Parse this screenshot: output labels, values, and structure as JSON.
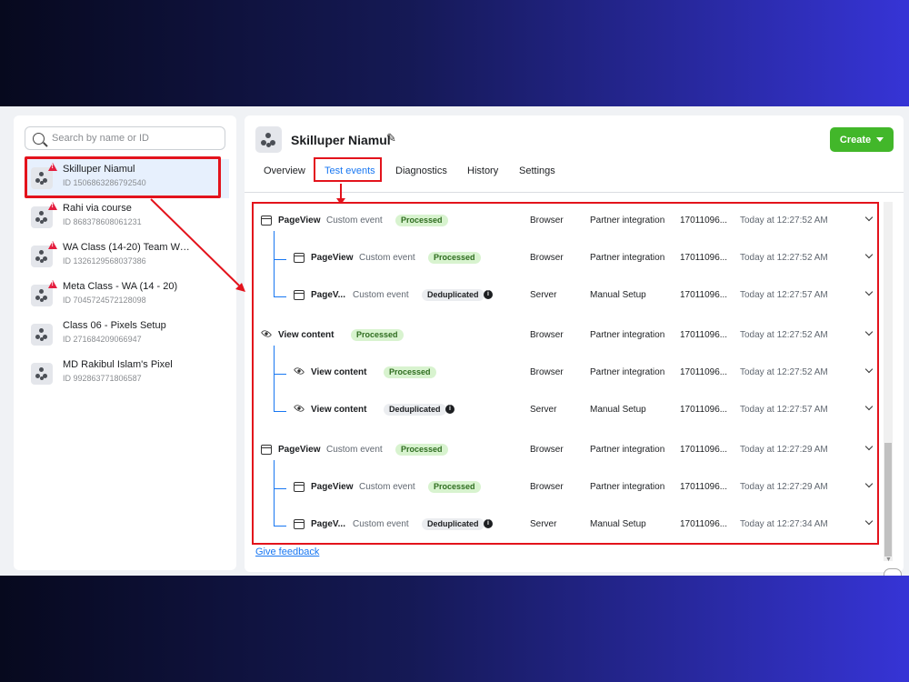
{
  "search": {
    "placeholder": "Search by name or ID"
  },
  "pixels": [
    {
      "name": "Skilluper Niamul",
      "id": "ID 1506863286792540",
      "warning": true,
      "selected": true
    },
    {
      "name": "Rahi via course",
      "id": "ID 868378608061231",
      "warning": true,
      "selected": false
    },
    {
      "name": "WA Class (14-20) Team Wor...",
      "id": "ID 1326129568037386",
      "warning": true,
      "selected": false
    },
    {
      "name": "Meta Class - WA (14 - 20)",
      "id": "ID 7045724572128098",
      "warning": true,
      "selected": false
    },
    {
      "name": "Class 06 - Pixels Setup",
      "id": "ID 271684209066947",
      "warning": false,
      "selected": false
    },
    {
      "name": "MD Rakibul Islam's Pixel",
      "id": "ID 992863771806587",
      "warning": false,
      "selected": false
    }
  ],
  "header": {
    "title": "Skilluper Niamul",
    "create_label": "Create"
  },
  "tabs": [
    {
      "label": "Overview",
      "active": false
    },
    {
      "label": "Test events",
      "active": true
    },
    {
      "label": "Diagnostics",
      "active": false
    },
    {
      "label": "History",
      "active": false
    },
    {
      "label": "Settings",
      "active": false
    }
  ],
  "events": [
    {
      "icon": "page-icon",
      "name": "PageView",
      "sub": "Custom event",
      "status": "Processed",
      "source": "Browser",
      "setup": "Partner integration",
      "event_id": "17011096...",
      "time": "Today at 12:27:52 AM",
      "child": false
    },
    {
      "icon": "page-icon",
      "name": "PageView",
      "sub": "Custom event",
      "status": "Processed",
      "source": "Browser",
      "setup": "Partner integration",
      "event_id": "17011096...",
      "time": "Today at 12:27:52 AM",
      "child": true
    },
    {
      "icon": "page-icon",
      "name": "PageV...",
      "sub": "Custom event",
      "status": "Deduplicated",
      "source": "Server",
      "setup": "Manual Setup",
      "event_id": "17011096...",
      "time": "Today at 12:27:57 AM",
      "child": true
    },
    {
      "icon": "eye-icon",
      "name": "View content",
      "sub": "",
      "status": "Processed",
      "source": "Browser",
      "setup": "Partner integration",
      "event_id": "17011096...",
      "time": "Today at 12:27:52 AM",
      "child": false
    },
    {
      "icon": "eye-icon",
      "name": "View content",
      "sub": "",
      "status": "Processed",
      "source": "Browser",
      "setup": "Partner integration",
      "event_id": "17011096...",
      "time": "Today at 12:27:52 AM",
      "child": true
    },
    {
      "icon": "eye-icon",
      "name": "View content",
      "sub": "",
      "status": "Deduplicated",
      "source": "Server",
      "setup": "Manual Setup",
      "event_id": "17011096...",
      "time": "Today at 12:27:57 AM",
      "child": true
    },
    {
      "icon": "page-icon",
      "name": "PageView",
      "sub": "Custom event",
      "status": "Processed",
      "source": "Browser",
      "setup": "Partner integration",
      "event_id": "17011096...",
      "time": "Today at 12:27:29 AM",
      "child": false
    },
    {
      "icon": "page-icon",
      "name": "PageView",
      "sub": "Custom event",
      "status": "Processed",
      "source": "Browser",
      "setup": "Partner integration",
      "event_id": "17011096...",
      "time": "Today at 12:27:29 AM",
      "child": true
    },
    {
      "icon": "page-icon",
      "name": "PageV...",
      "sub": "Custom event",
      "status": "Deduplicated",
      "source": "Server",
      "setup": "Manual Setup",
      "event_id": "17011096...",
      "time": "Today at 12:27:34 AM",
      "child": true
    }
  ],
  "feedback_label": "Give feedback",
  "colors": {
    "accent": "#1877f2",
    "highlight": "#e3131c",
    "create": "#42b72a",
    "processed_bg": "#d8f3cf"
  }
}
